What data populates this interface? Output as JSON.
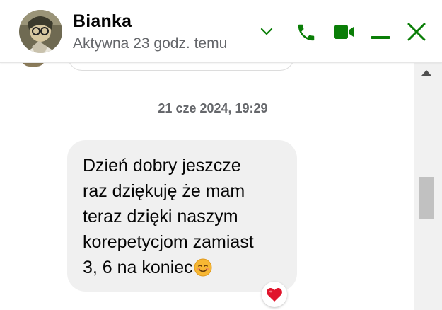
{
  "header": {
    "contact_name": "Bianka",
    "status": "Aktywna 23 godz. temu",
    "icons": {
      "chevron": "chevron-down-icon",
      "call": "phone-icon",
      "video": "video-camera-icon",
      "minimize": "minimize-icon",
      "close": "close-icon"
    }
  },
  "conversation": {
    "timestamp": "21 cze 2024, 19:29",
    "message": {
      "lines": [
        "Dzień dobry jeszcze",
        "raz dziękuję że mam",
        "teraz dzięki naszym",
        "korepetycjom zamiast",
        "3, 6 na koniec"
      ],
      "emoji": "smiling-face-emoji",
      "reaction": "heart-reaction-icon"
    }
  },
  "colors": {
    "accent": "#0a7e07",
    "bubble_bg": "#f0f0f0",
    "text_primary": "#050505",
    "text_secondary": "#65676b",
    "reaction_heart": "#e0142b"
  }
}
